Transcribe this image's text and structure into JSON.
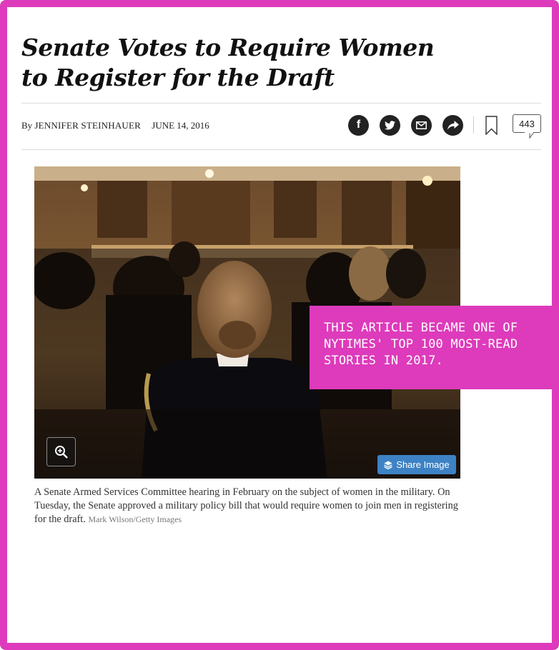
{
  "article": {
    "headline": "Senate Votes to Require Women\nto Register for the Draft",
    "byline_prefix": "By",
    "author": "JENNIFER STEINHAUER",
    "date": "JUNE 14, 2016",
    "comment_count": "443"
  },
  "share_bar": {
    "icons": [
      "facebook-icon",
      "twitter-icon",
      "email-icon",
      "share-arrow-icon",
      "bookmark-icon",
      "comment-icon"
    ],
    "facebook_glyph": "f"
  },
  "photo": {
    "share_button_label": "Share Image",
    "caption": "A Senate Armed Services Committee hearing in February on the subject of women in the military. On Tuesday, the Senate approved a military policy bill that would require women to join men in registering for the draft.",
    "credit": "Mark Wilson/Getty Images"
  },
  "callout": {
    "text": "THIS ARTICLE BECAME ONE OF\nNYTIMES' TOP 100 MOST-READ\nSTORIES IN 2017."
  },
  "colors": {
    "frame": "#dd3bbb",
    "callout_bg": "#dd3bbb",
    "share_button": "#3d82c4"
  }
}
